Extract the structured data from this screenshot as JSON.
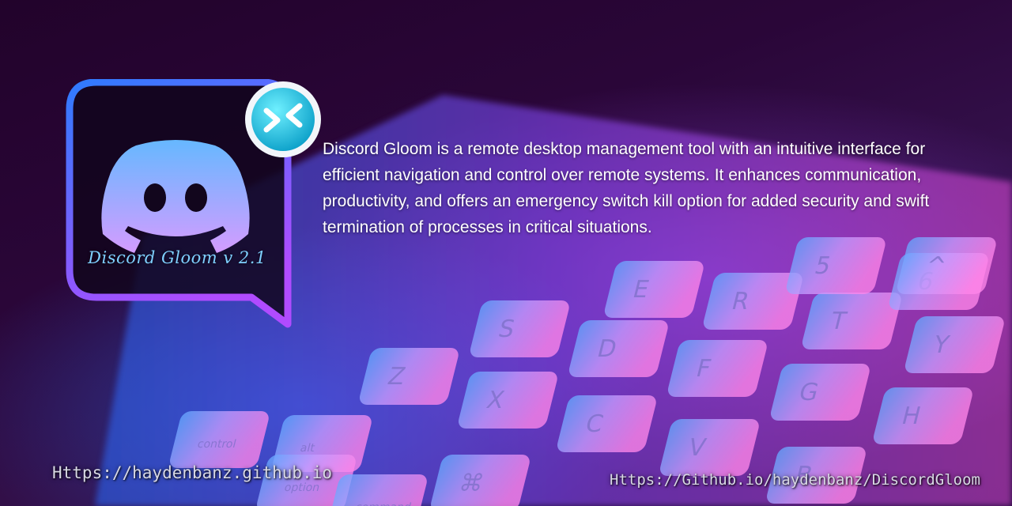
{
  "logo": {
    "caption": "Discord Gloom v 2.1",
    "icon": "discord-logo-icon",
    "badge_icon": "remote-desktop-icon"
  },
  "description": "Discord Gloom is a remote desktop management tool with an intuitive interface for efficient navigation and control over remote systems. It enhances communication, productivity, and offers an emergency switch kill option for added security and swift termination of processes in critical situations.",
  "links": {
    "left": "Https://haydenbanz.github.io",
    "right": "Https://Github.io/haydenbanz/DiscordGloom"
  },
  "keyboard": {
    "key_labels": [
      "E",
      "R",
      "T",
      "Y",
      "S",
      "D",
      "F",
      "G",
      "H",
      "Z",
      "X",
      "C",
      "V",
      "B",
      "5",
      "6",
      "^",
      "control",
      "alt",
      "option",
      "command",
      "⌘"
    ]
  },
  "colors": {
    "frame_top": "#2f7bff",
    "frame_bottom": "#b04bff",
    "caption": "#7fd0ff",
    "text": "#ffffff"
  }
}
